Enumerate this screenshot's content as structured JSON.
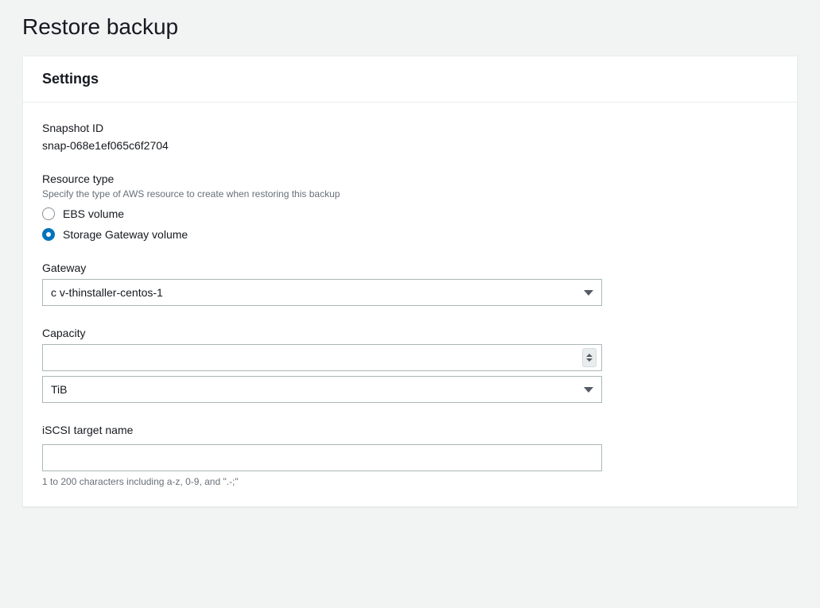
{
  "page": {
    "title": "Restore backup"
  },
  "panel": {
    "heading": "Settings"
  },
  "snapshot": {
    "label": "Snapshot ID",
    "value": "snap-068e1ef065c6f2704"
  },
  "resourceType": {
    "label": "Resource type",
    "description": "Specify the type of AWS resource to create when restoring this backup",
    "options": {
      "ebs": "EBS volume",
      "sgw": "Storage Gateway volume"
    },
    "selected": "sgw"
  },
  "gateway": {
    "label": "Gateway",
    "value": "c           v-thinstaller-centos-1"
  },
  "capacity": {
    "label": "Capacity",
    "value": "",
    "unit": "TiB"
  },
  "iscsi": {
    "label": "iSCSI target name",
    "value": "",
    "hint": "1 to 200 characters including a-z, 0-9, and \".-;\""
  }
}
